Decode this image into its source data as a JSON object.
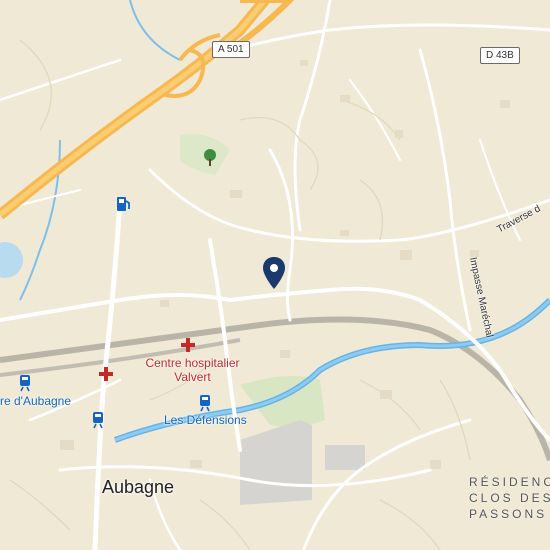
{
  "road_shields": [
    {
      "id": "a501",
      "text": "A 501"
    },
    {
      "id": "d43b",
      "text": "D 43B"
    }
  ],
  "labels": {
    "hospital": [
      "Centre hospitalier",
      "Valvert"
    ],
    "station": "re d'Aubagne",
    "les_defensions": "Les Défensions",
    "town": "Aubagne",
    "residence": [
      "RÉSIDENCE",
      "CLOS DES",
      "PASSONS"
    ],
    "traverse": "Traverse d",
    "impasse": "Impasse Maréchal"
  },
  "icons": [
    "location-pin-icon",
    "hospital-cross-icon",
    "fuel-station-icon",
    "park-tree-icon",
    "train-station-icon",
    "tram-stop-icon"
  ],
  "colors": {
    "background": "#efe9d6",
    "motorway": "#f7b84f",
    "river": "#64b5e8",
    "pin": "#1a3a6e",
    "hospital": "#c62828",
    "transit": "#1565c0"
  }
}
